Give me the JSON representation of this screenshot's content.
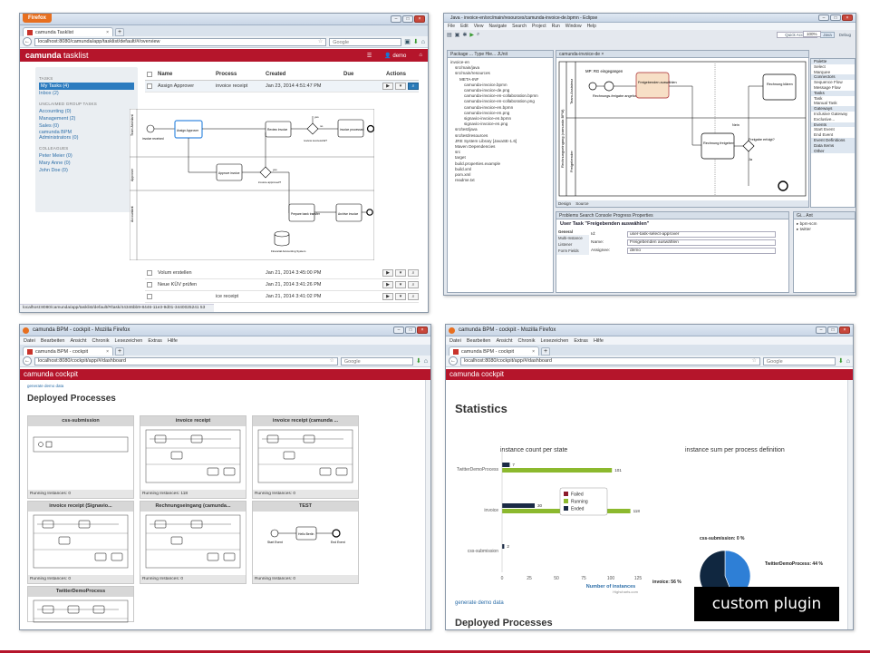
{
  "win1": {
    "browser_label": "Firefox",
    "tab": "camunda Tasklist",
    "url": "localhost:8080/camunda/app/tasklist/default/#/overview",
    "search": "Google",
    "app_logo_bold": "camunda",
    "app_logo_rest": " tasklist",
    "user": "demo",
    "sidebar": {
      "tasks_heading": "TASKS",
      "tasks": [
        "My Tasks (4)",
        "Inbox (2)"
      ],
      "group_heading": "UNCLAIMED GROUP TASKS",
      "groups": [
        "Accounting (0)",
        "Management (2)",
        "Sales (0)",
        "camunda BPM",
        "Administrators (0)"
      ],
      "colleagues_heading": "COLLEAGUES",
      "colleagues": [
        "Peter Meier (0)",
        "Mary Anne (0)",
        "John Doe (0)"
      ]
    },
    "table": {
      "headers": [
        "Name",
        "Process",
        "Created",
        "Due",
        "Actions"
      ],
      "rows": [
        {
          "name": "Assign Approver",
          "process": "invoice receipt",
          "created": "Jan 23, 2014 4:51:47 PM"
        },
        {
          "name": "Volum erstellen",
          "process": "",
          "created": "Jan 21, 2014 3:45:00 PM"
        },
        {
          "name": "Neue KÜV prüfen",
          "process": "",
          "created": "Jan 21, 2014 3:41:26 PM"
        },
        {
          "name": "",
          "process": "ice receipt",
          "created": "Jan 21, 2014 3:41:02 PM"
        }
      ]
    },
    "diagram_labels": {
      "lane1": "Team Assistant",
      "lane2": "Approver",
      "lane3": "Accountant",
      "tasks": [
        "Assign Approver",
        "Review Invoice",
        "Approve invoice",
        "Prepare bank transfer",
        "Archive invoice",
        "invoice processed"
      ],
      "start": "invoice received",
      "gw1": "review successful?",
      "gw2": "invoice approved?",
      "yes": "yes",
      "no": "no",
      "db": "Financial Accounting System"
    },
    "status_url": "localhost:8080/camunda/app/tasklist/default/#/task/44346bb9-8446-11e3-9d01-3440025241 53"
  },
  "win2": {
    "title": "Java - invoice-en/src/main/resources/camunda-invoice-de.bpmn - Eclipse",
    "menu": [
      "File",
      "Edit",
      "View",
      "Navigate",
      "Search",
      "Project",
      "Run",
      "Window",
      "Help"
    ],
    "quick_access": "Quick Access",
    "perspectives": [
      "Java",
      "Debug"
    ],
    "zoom": "100%",
    "pkg_tabs": "Package ...  Type Hie...  JUnit",
    "tree": [
      "invoice-en",
      "src/main/java",
      "src/main/resources",
      "META-INF",
      "camunda-invoice.bpmn",
      "camunda-invoice-de.png",
      "camunda-invoice-en-collaboration.bpmn",
      "camunda-invoice-en-collaboration.png",
      "camunda-invoice-en.bpmn",
      "camunda-invoice-en.png",
      "signavio-invoice-en.bpmn",
      "signavio-invoice-en.png",
      "src/test/java",
      "src/test/resources",
      "JRE System Library [JavaSE-1.6]",
      "Maven Dependencies",
      "src",
      "target",
      "build.properties.example",
      "build.xml",
      "pom.xml",
      "readme.txt"
    ],
    "editor_tab": "camunda-invoice-de",
    "pool_label": "Rechnungseingang (camunda BPM)",
    "lane1": "Team-Assistenz",
    "lane2": "Freigebender",
    "diagram": {
      "start": "MP: RG eingegangen",
      "assign": "Rechnungs-freigabe angefordert",
      "task1": "Freigebenden auswählen",
      "task2": "Rechnung klären",
      "task3": "Rechnung freigeben",
      "gw": "Freigabe erfolgt?",
      "nein": "Nein",
      "ja": "Ja"
    },
    "editor_bottom_tabs": [
      "Design",
      "Source"
    ],
    "palette": [
      {
        "cat": true,
        "t": "Palette"
      },
      {
        "t": "Select"
      },
      {
        "t": "Marquee"
      },
      {
        "cat": true,
        "t": "Connectors"
      },
      {
        "t": "Sequence Flow"
      },
      {
        "t": "Message Flow"
      },
      {
        "cat": true,
        "t": "Tasks"
      },
      {
        "t": "Task"
      },
      {
        "t": "Manual Task"
      },
      {
        "cat": true,
        "t": "Gateways"
      },
      {
        "t": "Inclusive Gateway"
      },
      {
        "t": "Exclusive..."
      },
      {
        "cat": true,
        "t": "Events"
      },
      {
        "t": "Start Event"
      },
      {
        "t": "End Event"
      },
      {
        "cat": true,
        "t": "Event Definitions"
      },
      {
        "cat": true,
        "t": "Data Items"
      },
      {
        "cat": true,
        "t": "Other"
      }
    ],
    "props_tabs": "Problems  Search  Console  Progress  Properties",
    "props_title": "User Task \"Freigebenden auswählen\"",
    "props_side": [
      "General",
      "Multi-Instance",
      "Listener",
      "Form Fields"
    ],
    "props_rows": [
      {
        "label": "Id:",
        "value": "user-task-select-approver"
      },
      {
        "label": "Name:",
        "value": "Freigebenden auswählen"
      },
      {
        "label": "Assignee:",
        "value": "demo"
      }
    ],
    "git_tab": "Gi...  Ant",
    "git_items": [
      "bpm-scm",
      "twitter"
    ]
  },
  "win3": {
    "title": "camunda BPM - cockpit - Mozilla Firefox",
    "menu": [
      "Datei",
      "Bearbeiten",
      "Ansicht",
      "Chronik",
      "Lesezeichen",
      "Extras",
      "Hilfe"
    ],
    "tab": "camunda BPM - cockpit",
    "url": "localhost:8080/cockpit/app/#/dashboard",
    "search": "Google",
    "logo_rest": "camunda cockpit",
    "gen_link": "generate demo data",
    "heading": "Deployed Processes",
    "cards": [
      {
        "name": "css-submission",
        "instances": "Running Instances: 0"
      },
      {
        "name": "invoice receipt",
        "instances": "Running Instances: 118"
      },
      {
        "name": "invoice receipt (camunda ...",
        "instances": "Running Instances: 0"
      },
      {
        "name": "invoice receipt (Signavio...",
        "instances": "Running Instances: 0"
      },
      {
        "name": "Rechnungseingang (camunda...",
        "instances": "Running Instances: 0"
      },
      {
        "name": "TEST",
        "instances": "Running Instances: 0"
      },
      {
        "name": "TwitterDemoProcess",
        "instances": ""
      }
    ],
    "test_labels": [
      "Start Event",
      "Hello Berlin",
      "End Event"
    ]
  },
  "win4": {
    "title": "camunda BPM - cockpit - Mozilla Firefox",
    "menu": [
      "Datei",
      "Bearbeiten",
      "Ansicht",
      "Chronik",
      "Lesezeichen",
      "Extras",
      "Hilfe"
    ],
    "tab": "camunda BPM - cockpit",
    "url": "localhost:8080/cockpit/app/#/dashboard",
    "search": "Google",
    "logo_rest": "camunda cockpit",
    "stats_heading": "Statistics",
    "bar_title": "instance count per state",
    "pie_title": "instance sum per process definition",
    "x_axis_label": "Number of instances",
    "credit": "Highcharts.com",
    "legend": [
      "Failed",
      "Running",
      "Ended"
    ],
    "gen_link": "generate demo data",
    "deployed": "Deployed Processes"
  },
  "badge": "custom plugin",
  "colors": {
    "camunda_red": "#b5152b",
    "failed": "#8b1a2a",
    "running": "#8cb92e",
    "ended": "#1a2a45",
    "pie_blue": "#2e7fd6",
    "pie_navy": "#102740"
  },
  "chart_data": [
    {
      "type": "bar",
      "title": "instance count per state",
      "xlabel": "Number of instances",
      "ylabel": "",
      "categories": [
        "TwitterDemoProcess",
        "invoice",
        "css-submission"
      ],
      "series": [
        {
          "name": "Failed",
          "values": [
            0,
            0,
            0
          ]
        },
        {
          "name": "Running",
          "values": [
            101,
            118,
            0
          ]
        },
        {
          "name": "Ended",
          "values": [
            7,
            30,
            2
          ]
        }
      ],
      "xlim": [
        0,
        125
      ],
      "ticks": [
        0,
        25,
        50,
        75,
        100,
        125
      ],
      "legend": "inside-center"
    },
    {
      "type": "pie",
      "title": "instance sum per process definition",
      "labels": [
        "css-submission",
        "TwitterDemoProcess",
        "invoice"
      ],
      "values": [
        0,
        44,
        56
      ],
      "value_labels": [
        "css-submission: 0 %",
        "TwitterDemoProcess: 44 %",
        "invoice: 56 %"
      ]
    }
  ]
}
